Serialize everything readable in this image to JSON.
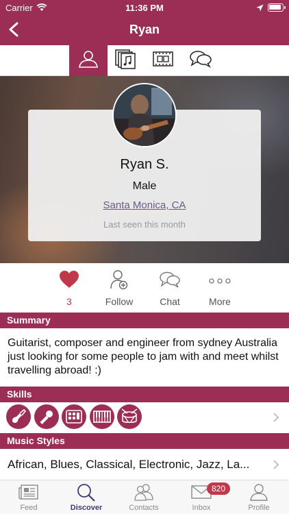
{
  "status_bar": {
    "carrier": "Carrier",
    "time": "11:36 PM"
  },
  "nav": {
    "title": "Ryan"
  },
  "tabs": [
    {
      "icon": "person-icon",
      "active": true
    },
    {
      "icon": "music-files-icon",
      "active": false
    },
    {
      "icon": "film-icon",
      "active": false
    },
    {
      "icon": "chat-icon",
      "active": false
    }
  ],
  "profile": {
    "name": "Ryan S.",
    "gender": "Male",
    "location": "Santa Monica, CA",
    "last_seen": "Last seen this month"
  },
  "actions": {
    "likes_count": "3",
    "follow": "Follow",
    "chat": "Chat",
    "more": "More"
  },
  "summary": {
    "heading": "Summary",
    "text": "Guitarist, composer and engineer from sydney Australia just looking for some people to jam with and meet whilst travelling abroad! :)"
  },
  "skills": {
    "heading": "Skills",
    "items": [
      "guitar-icon",
      "microphone-icon",
      "drum-machine-icon",
      "keyboard-icon",
      "drum-icon"
    ]
  },
  "music_styles": {
    "heading": "Music Styles",
    "text": "African, Blues, Classical, Electronic, Jazz, La..."
  },
  "tabbar": {
    "feed": "Feed",
    "discover": "Discover",
    "contacts": "Contacts",
    "inbox": "Inbox",
    "inbox_badge": "820",
    "profile": "Profile"
  },
  "colors": {
    "brand": "#9c2d55",
    "heart": "#c0394b",
    "link": "#6a5b86"
  }
}
